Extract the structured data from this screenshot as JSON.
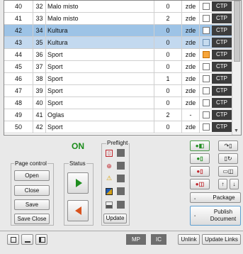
{
  "table": {
    "rows": [
      {
        "num": "40",
        "page": "32",
        "name": "Malo misto",
        "count": "0",
        "loc": "zde",
        "check": "none",
        "ctp": "CTP",
        "selected": false
      },
      {
        "num": "41",
        "page": "33",
        "name": "Malo misto",
        "count": "2",
        "loc": "zde",
        "check": "none",
        "ctp": "CTP",
        "selected": false
      },
      {
        "num": "42",
        "page": "34",
        "name": "Kultura",
        "count": "0",
        "loc": "zde",
        "check": "none",
        "ctp": "CTP",
        "selected": true
      },
      {
        "num": "43",
        "page": "35",
        "name": "Kultura",
        "count": "0",
        "loc": "zde",
        "check": "blue",
        "ctp": "CTP",
        "selected": true
      },
      {
        "num": "44",
        "page": "36",
        "name": "Sport",
        "count": "0",
        "loc": "zde",
        "check": "orange",
        "ctp": "CTP",
        "selected": false
      },
      {
        "num": "45",
        "page": "37",
        "name": "Sport",
        "count": "0",
        "loc": "zde",
        "check": "none",
        "ctp": "CTP",
        "selected": false
      },
      {
        "num": "46",
        "page": "38",
        "name": "Sport",
        "count": "1",
        "loc": "zde",
        "check": "none",
        "ctp": "CTP",
        "selected": false
      },
      {
        "num": "47",
        "page": "39",
        "name": "Sport",
        "count": "0",
        "loc": "zde",
        "check": "none",
        "ctp": "CTP",
        "selected": false
      },
      {
        "num": "48",
        "page": "40",
        "name": "Sport",
        "count": "0",
        "loc": "zde",
        "check": "none",
        "ctp": "CTP",
        "selected": false
      },
      {
        "num": "49",
        "page": "41",
        "name": "Oglas",
        "count": "2",
        "loc": "-",
        "check": "none",
        "ctp": "CTP",
        "selected": false
      },
      {
        "num": "50",
        "page": "42",
        "name": "Sport",
        "count": "0",
        "loc": "zde",
        "check": "none",
        "ctp": "CTP",
        "selected": false
      }
    ]
  },
  "status": {
    "on_label": "ON",
    "status_label": "Status"
  },
  "page_control": {
    "label": "Page control",
    "open": "Open",
    "close": "Close",
    "save": "Save",
    "save_close": "Save Close"
  },
  "preflight": {
    "label": "Preflight",
    "update": "Update",
    "icons": [
      "pdf-frame-icon",
      "link-icon",
      "warning-icon",
      "color-icon",
      "image-icon"
    ]
  },
  "right_panel": {
    "package": "Package",
    "publish_line1": "Publish",
    "publish_line2": "Document"
  },
  "bottom_bar": {
    "mp": "MP",
    "ic": "IC",
    "unlink": "Unlink",
    "update_links": "Update Links"
  },
  "colors": {
    "selected_row": "#9dc3e6",
    "on_green": "#1a8c1a",
    "ctp_bg": "#3c3c3c",
    "orange_flag": "#f7a53a"
  }
}
